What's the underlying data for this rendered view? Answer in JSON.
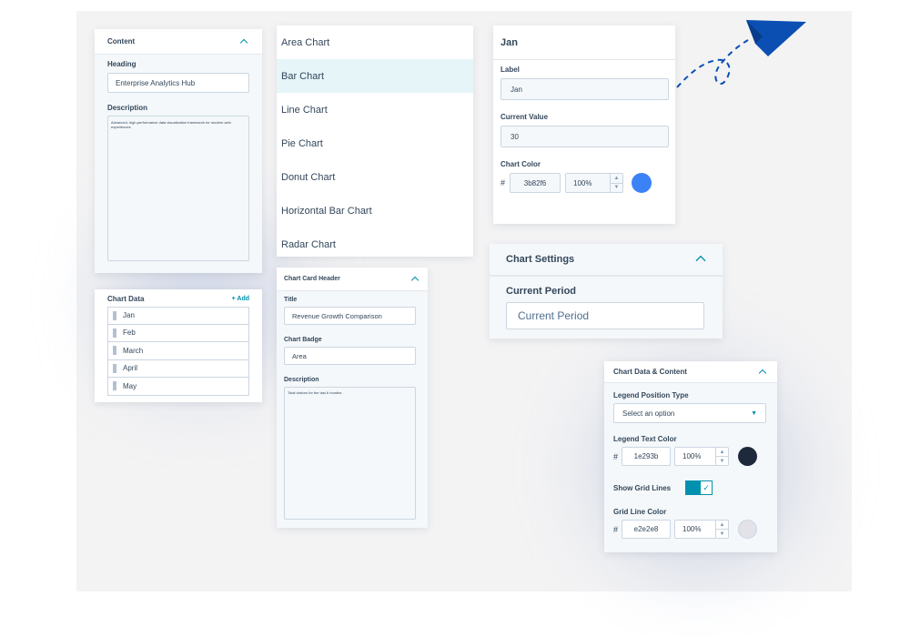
{
  "content_panel": {
    "title": "Content",
    "heading_label": "Heading",
    "heading_value": "Enterprise Analytics Hub",
    "description_label": "Description",
    "description_value": "Advanced, high-performance data visualization framework for modern web experiences"
  },
  "chart_types": {
    "items": [
      "Area Chart",
      "Bar Chart",
      "Line Chart",
      "Pie Chart",
      "Donut Chart",
      "Horizontal Bar Chart",
      "Radar Chart"
    ],
    "selected": "Bar Chart"
  },
  "jan_panel": {
    "title": "Jan",
    "label_label": "Label",
    "label_value": "Jan",
    "value_label": "Current Value",
    "value_value": "30",
    "color_label": "Chart Color",
    "hash": "#",
    "color_hex": "3b82f6",
    "opacity": "100%",
    "swatch_color": "#3b82f6"
  },
  "chart_data_panel": {
    "title": "Chart Data",
    "add_label": "+ Add",
    "rows": [
      "Jan",
      "Feb",
      "March",
      "April",
      "May"
    ]
  },
  "card_header_panel": {
    "title": "Chart Card Header",
    "title_label": "Title",
    "title_value": "Revenue Growth Comparison",
    "badge_label": "Chart Badge",
    "badge_value": "Area",
    "description_label": "Description",
    "description_value": "Total visitors for the last 6 months"
  },
  "chart_settings_panel": {
    "title": "Chart Settings",
    "period_label": "Current Period",
    "period_value": "Current Period"
  },
  "data_content_panel": {
    "title": "Chart Data & Content",
    "legend_position_label": "Legend Position Type",
    "legend_position_placeholder": "Select an option",
    "legend_text_color_label": "Legend Text Color",
    "hash": "#",
    "legend_text_hex": "1e293b",
    "legend_text_opacity": "100%",
    "legend_text_swatch": "#1e293b",
    "grid_lines_label": "Show Grid Lines",
    "grid_lines_on": true,
    "grid_color_label": "Grid Line Color",
    "grid_color_hex": "e2e2e8",
    "grid_color_opacity": "100%",
    "grid_color_swatch": "#e2e2e8"
  },
  "colors": {
    "accent": "#0091ae",
    "text": "#33475b",
    "arrow": "#0b4fb3"
  },
  "icons": {
    "collapse": "chevron-up-icon",
    "drag": "drag-handle-icon",
    "dropdown": "caret-down-icon",
    "check": "check-icon",
    "decor": "paper-plane-icon"
  }
}
